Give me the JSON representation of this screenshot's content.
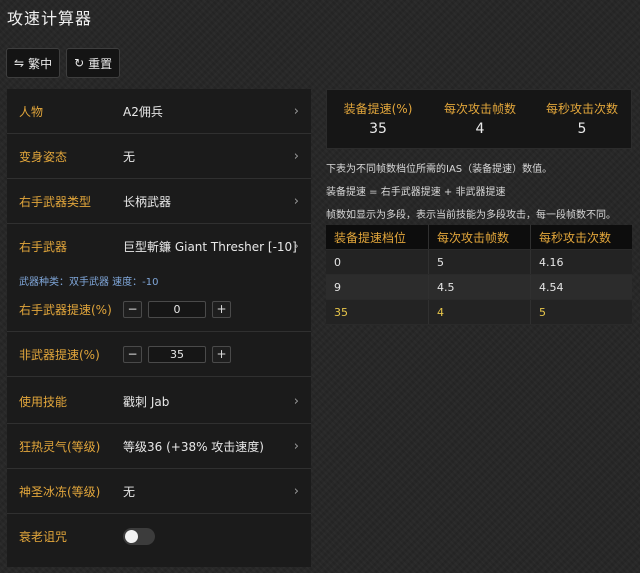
{
  "page": {
    "title": "攻速计算器"
  },
  "toolbar": {
    "lang_icon": "⇋",
    "lang_label": "繁中",
    "reset_icon": "↻",
    "reset_label": "重置"
  },
  "settings": {
    "character": {
      "label": "人物",
      "value": "A2佣兵"
    },
    "morph": {
      "label": "变身姿态",
      "value": "无"
    },
    "weapon_type": {
      "label": "右手武器类型",
      "value": "长柄武器"
    },
    "weapon": {
      "label": "右手武器",
      "value": "巨型斬鐮 Giant Thresher [-10]"
    },
    "weapon_info": "武器种类：双手武器 速度：-10",
    "weapon_ias": {
      "label": "右手武器提速(%)",
      "value": "0",
      "minus": "−",
      "plus": "+"
    },
    "other_ias": {
      "label": "非武器提速(%)",
      "value": "35",
      "minus": "−",
      "plus": "+"
    },
    "skill": {
      "label": "使用技能",
      "value": "戳刺 Jab"
    },
    "fanaticism": {
      "label": "狂热灵气(等级)",
      "value": "等级36 (+38% 攻击速度)"
    },
    "holy_freeze": {
      "label": "神圣冰冻(等级)",
      "value": "无"
    },
    "decrepify": {
      "label": "衰老诅咒",
      "on": false
    },
    "chevron": "›"
  },
  "stats": [
    {
      "label": "装备提速(%)",
      "value": "35"
    },
    {
      "label": "每次攻击帧数",
      "value": "4"
    },
    {
      "label": "每秒攻击次数",
      "value": "5"
    }
  ],
  "notes": [
    "下表为不同帧数档位所需的IAS（装备提速）数值。",
    "装备提速 = 右手武器提速 + 非武器提速",
    "帧数如显示为多段，表示当前技能为多段攻击，每一段帧数不同。"
  ],
  "table": {
    "headers": [
      "装备提速档位",
      "每次攻击帧数",
      "每秒攻击次数"
    ],
    "rows": [
      [
        "0",
        "5",
        "4.16"
      ],
      [
        "9",
        "4.5",
        "4.54"
      ],
      [
        "35",
        "4",
        "5"
      ]
    ]
  },
  "colors": {
    "accent": "#e2a63b",
    "highlight": "#e8c64a",
    "info": "#7fa6d9"
  }
}
